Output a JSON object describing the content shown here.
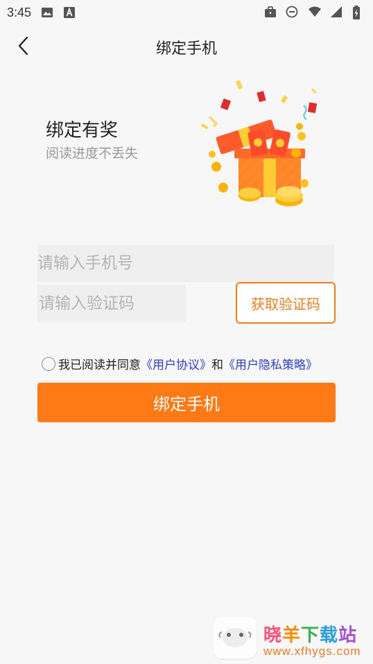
{
  "status_bar": {
    "time": "3:45",
    "left_icons": [
      "image-icon",
      "text-a-icon"
    ],
    "right_icons": [
      "briefcase-icon",
      "dnd-icon",
      "wifi-icon",
      "signal-icon",
      "battery-charging-icon"
    ]
  },
  "app_bar": {
    "back_icon": "chevron-left-icon",
    "title": "绑定手机"
  },
  "promo": {
    "title": "绑定有奖",
    "subtitle": "阅读进度不丢失",
    "illustration": "gift-box-coins-illustration"
  },
  "form": {
    "phone_placeholder": "请输入手机号",
    "phone_value": "",
    "code_placeholder": "请输入验证码",
    "code_value": "",
    "get_code_label": "获取验证码"
  },
  "agreement": {
    "prefix": "我已阅读并同意",
    "user_agreement": "《用户协议》",
    "conjunction": "和",
    "privacy_policy": "《用户隐私策略》",
    "checked": false
  },
  "primary_button": {
    "label": "绑定手机"
  },
  "watermark": {
    "name": "晓羊下载站",
    "url": "www.xfhygs.com"
  },
  "colors": {
    "accent": "#ff7a14",
    "link": "#2b3fd6",
    "background": "#f7f7f7",
    "input_bg": "#efefef"
  }
}
